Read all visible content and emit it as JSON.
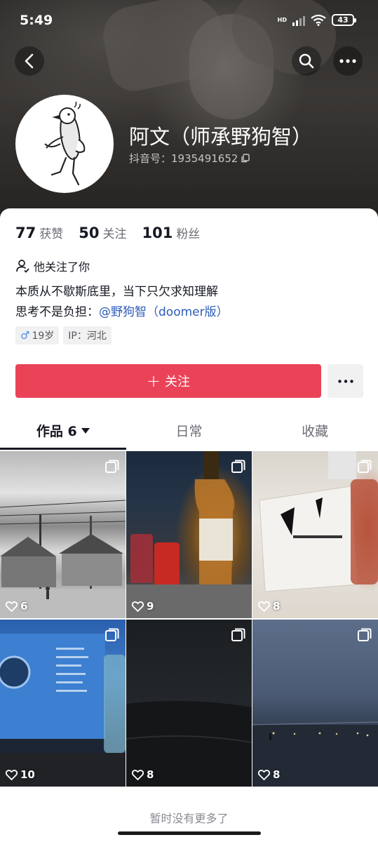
{
  "status_bar": {
    "time": "5:49",
    "network": "HD",
    "battery": "43"
  },
  "profile": {
    "nickname": "阿文（师承野狗智）",
    "douyin_id": "抖音号：1935491652"
  },
  "stats": [
    {
      "num": "77",
      "label": "获赞"
    },
    {
      "num": "50",
      "label": "关注"
    },
    {
      "num": "101",
      "label": "粉丝"
    }
  ],
  "follows_you": "他关注了你",
  "bio": {
    "line1": "本质从不歇斯底里，当下只欠求知理解",
    "line2_prefix": "思考不是负担：",
    "mention": "@野狗智（doomer版）"
  },
  "tags": {
    "gender_symbol": "♂",
    "age": "19岁",
    "ip": "IP：河北"
  },
  "follow_button": {
    "plus": "+",
    "label": "关注"
  },
  "tabs": [
    {
      "label": "作品 6",
      "active": true
    },
    {
      "label": "日常",
      "active": false
    },
    {
      "label": "收藏",
      "active": false
    }
  ],
  "posts": [
    {
      "likes": "6"
    },
    {
      "likes": "9"
    },
    {
      "likes": "8"
    },
    {
      "likes": "10"
    },
    {
      "likes": "8"
    },
    {
      "likes": "8"
    }
  ],
  "footer_tip": "暂时没有更多了",
  "colors": {
    "accent": "#ea4358",
    "mention": "#2b5bb8"
  }
}
